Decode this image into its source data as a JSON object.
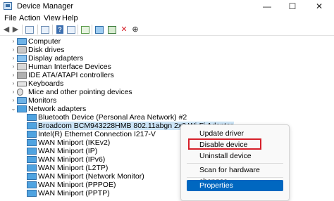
{
  "window": {
    "title": "Device Manager",
    "controls": {
      "minimize": "—",
      "maximize": "☐",
      "close": "✕"
    }
  },
  "menu": [
    "File",
    "Action",
    "View",
    "Help"
  ],
  "toolbar": {
    "back": "◀",
    "forward": "▶",
    "remove": "✕",
    "update": "⊕"
  },
  "tree": {
    "categories": [
      {
        "label": "Computer",
        "icon": "computer-icon"
      },
      {
        "label": "Disk drives",
        "icon": "disk-drive-icon"
      },
      {
        "label": "Display adapters",
        "icon": "display-adapter-icon"
      },
      {
        "label": "Human Interface Devices",
        "icon": "hid-icon"
      },
      {
        "label": "IDE ATA/ATAPI controllers",
        "icon": "ide-controller-icon"
      },
      {
        "label": "Keyboards",
        "icon": "keyboard-icon"
      },
      {
        "label": "Mice and other pointing devices",
        "icon": "mouse-icon"
      },
      {
        "label": "Monitors",
        "icon": "monitor-icon"
      }
    ],
    "expanded": {
      "label": "Network adapters",
      "icon": "network-adapter-icon",
      "children": [
        "Bluetooth Device (Personal Area Network) #2",
        "Broadcom BCM943228HMB 802.11abgn 2x2 Wi-Fi Adapter",
        "Intel(R) Ethernet Connection I217-V",
        "WAN Miniport (IKEv2)",
        "WAN Miniport (IP)",
        "WAN Miniport (IPv6)",
        "WAN Miniport (L2TP)",
        "WAN Miniport (Network Monitor)",
        "WAN Miniport (PPPOE)",
        "WAN Miniport (PPTP)"
      ],
      "selected_index": 1
    }
  },
  "context_menu": {
    "items": [
      "Update driver",
      "Disable device",
      "Uninstall device",
      "Scan for hardware changes",
      "Properties"
    ],
    "highlighted_item": "Disable device",
    "selected_item": "Properties",
    "highlight_color": "#d6202a",
    "selected_color": "#0067c0"
  }
}
